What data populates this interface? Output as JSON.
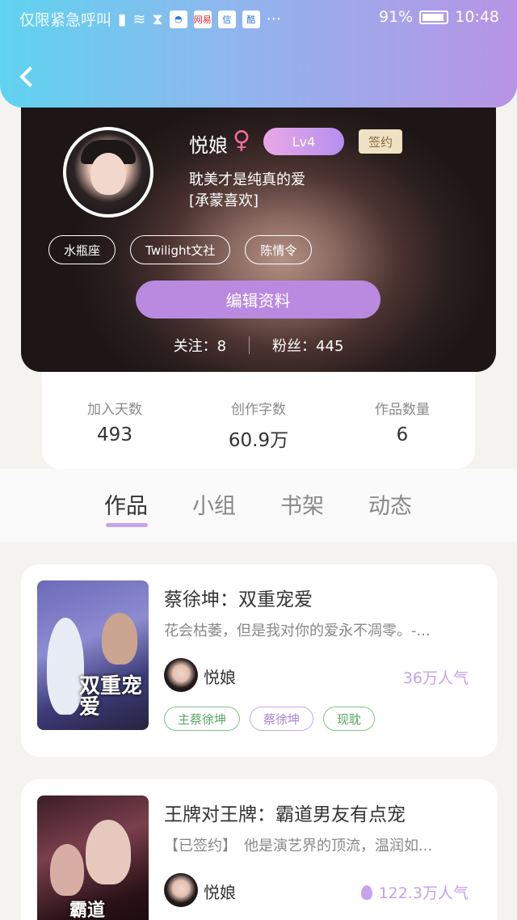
{
  "status_bar": {
    "left_text": "仅限紧急呼叫",
    "app_icons": [
      "网易",
      "信",
      "酷"
    ],
    "battery": "91%",
    "time": "10:48"
  },
  "profile": {
    "name": "悦娘",
    "gender_symbol": "♀",
    "level": "Lv4",
    "sign_badge": "签约",
    "bio_line1": "耽美才是纯真的爱",
    "bio_line2": "[承蒙喜欢]",
    "tags": [
      "水瓶座",
      "Twilight文社",
      "陈情令"
    ],
    "edit_button": "编辑资料",
    "follow_label": "关注：8",
    "fans_label": "粉丝：445"
  },
  "stats": [
    {
      "label": "加入天数",
      "value": "493"
    },
    {
      "label": "创作字数",
      "value": "60.9万"
    },
    {
      "label": "作品数量",
      "value": "6"
    }
  ],
  "tabs": [
    "作品",
    "小组",
    "书架",
    "动态"
  ],
  "active_tab": "作品",
  "works": [
    {
      "cover_text": "双重宠爱",
      "title": "蔡徐坤：双重宠爱",
      "desc": "花会枯萎，但是我对你的爱永不凋零。-...",
      "author": "悦娘",
      "popularity": "36万人气",
      "tags": [
        "主蔡徐坤",
        "蔡徐坤",
        "现耽"
      ]
    },
    {
      "cover_text": "霸道",
      "title": "王牌对王牌：霸道男友有点宠",
      "desc": "【已签约】　他是演艺界的顶流，温润如...",
      "author": "悦娘",
      "popularity": "122.3万人气"
    }
  ],
  "colors": {
    "header_gradient_start": "#5fd3f0",
    "header_gradient_end": "#b893e6",
    "accent_purple": "#b98ae0",
    "tag_green": "#5aa866",
    "tag_purple": "#aa86d5"
  }
}
